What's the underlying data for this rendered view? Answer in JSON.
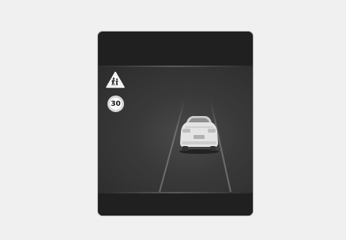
{
  "display": {
    "speed_limit": "30",
    "warning_icon": "children-crossing-icon",
    "vehicle_icon": "car-rear-icon"
  },
  "colors": {
    "background": "#f0f0f0",
    "cluster": "#1d1d1d",
    "sign_red": "#ffffff"
  }
}
